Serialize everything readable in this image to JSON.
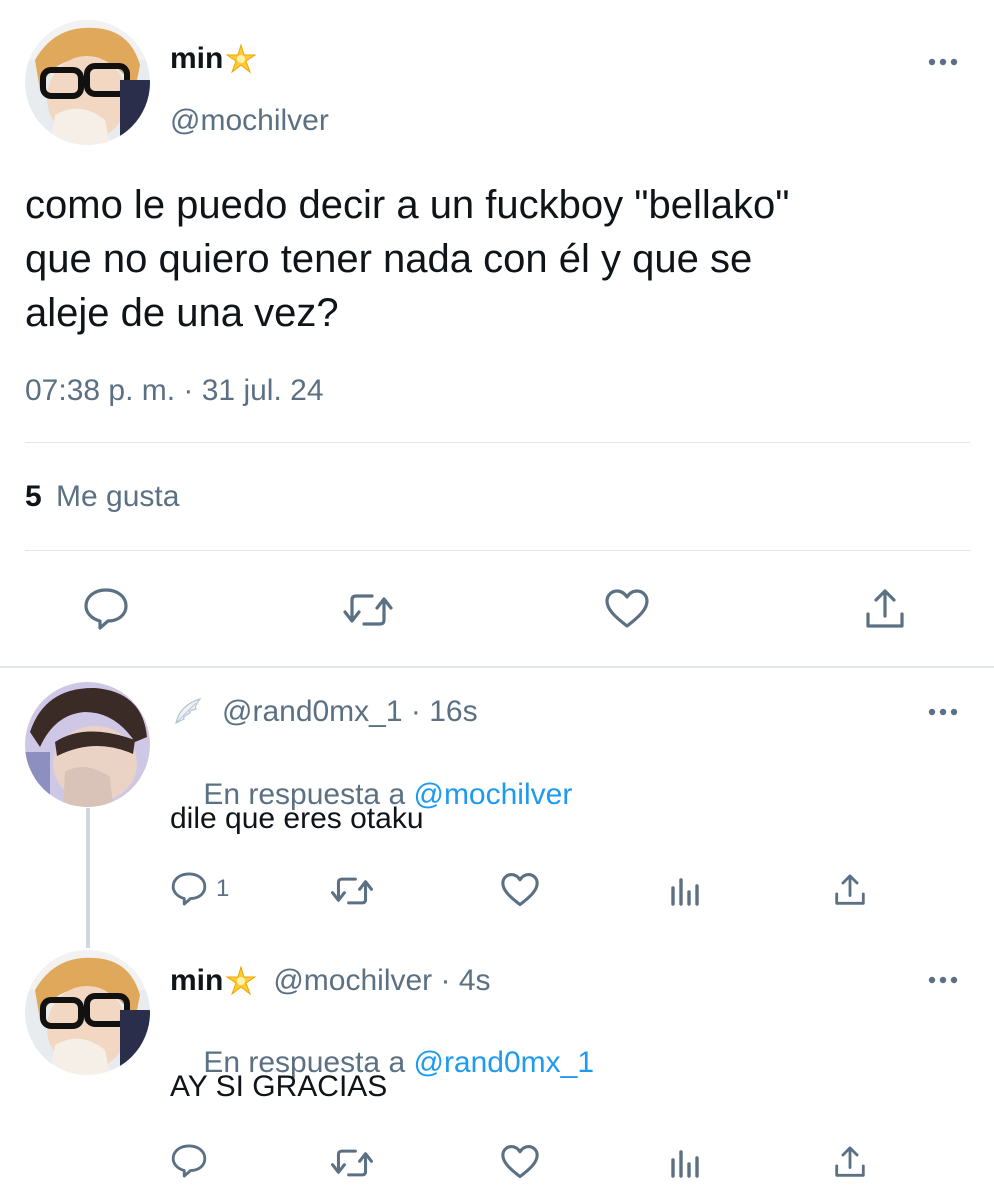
{
  "main_tweet": {
    "display_name": "min",
    "handle": "@mochilver",
    "text_lines": [
      "como le puedo decir a un fuckboy \"bellako\"",
      "que no quiero tener nada con él y que se",
      "aleje de una vez?"
    ],
    "timestamp": "07:38 p. m. · 31 jul. 24",
    "likes_count": "5",
    "likes_label": "Me gusta"
  },
  "reply1": {
    "handle": "@rand0mx_1",
    "time": " · 16s",
    "in_reply_prefix": "En respuesta a ",
    "in_reply_handle": "@mochilver",
    "text": "dile que eres otaku",
    "reply_count": "1"
  },
  "reply2": {
    "display_name": "min",
    "handle": "@mochilver",
    "time": " · 4s",
    "in_reply_prefix": "En respuesta a ",
    "in_reply_handle": "@rand0mx_1",
    "text": "AY SI GRACIAS"
  },
  "icons": {
    "reply": "speech-bubble",
    "retweet": "retweet-arrows",
    "like": "heart",
    "share": "upload-arrow",
    "views": "bar-chart",
    "more": "three-dots",
    "sparkle": "glowing-star-emoji",
    "wing": "angel-wing-emoji"
  },
  "colors": {
    "text": "#0f1419",
    "secondary": "#5b7083",
    "link": "#1d9bf0",
    "divider": "#e1e6ea"
  }
}
